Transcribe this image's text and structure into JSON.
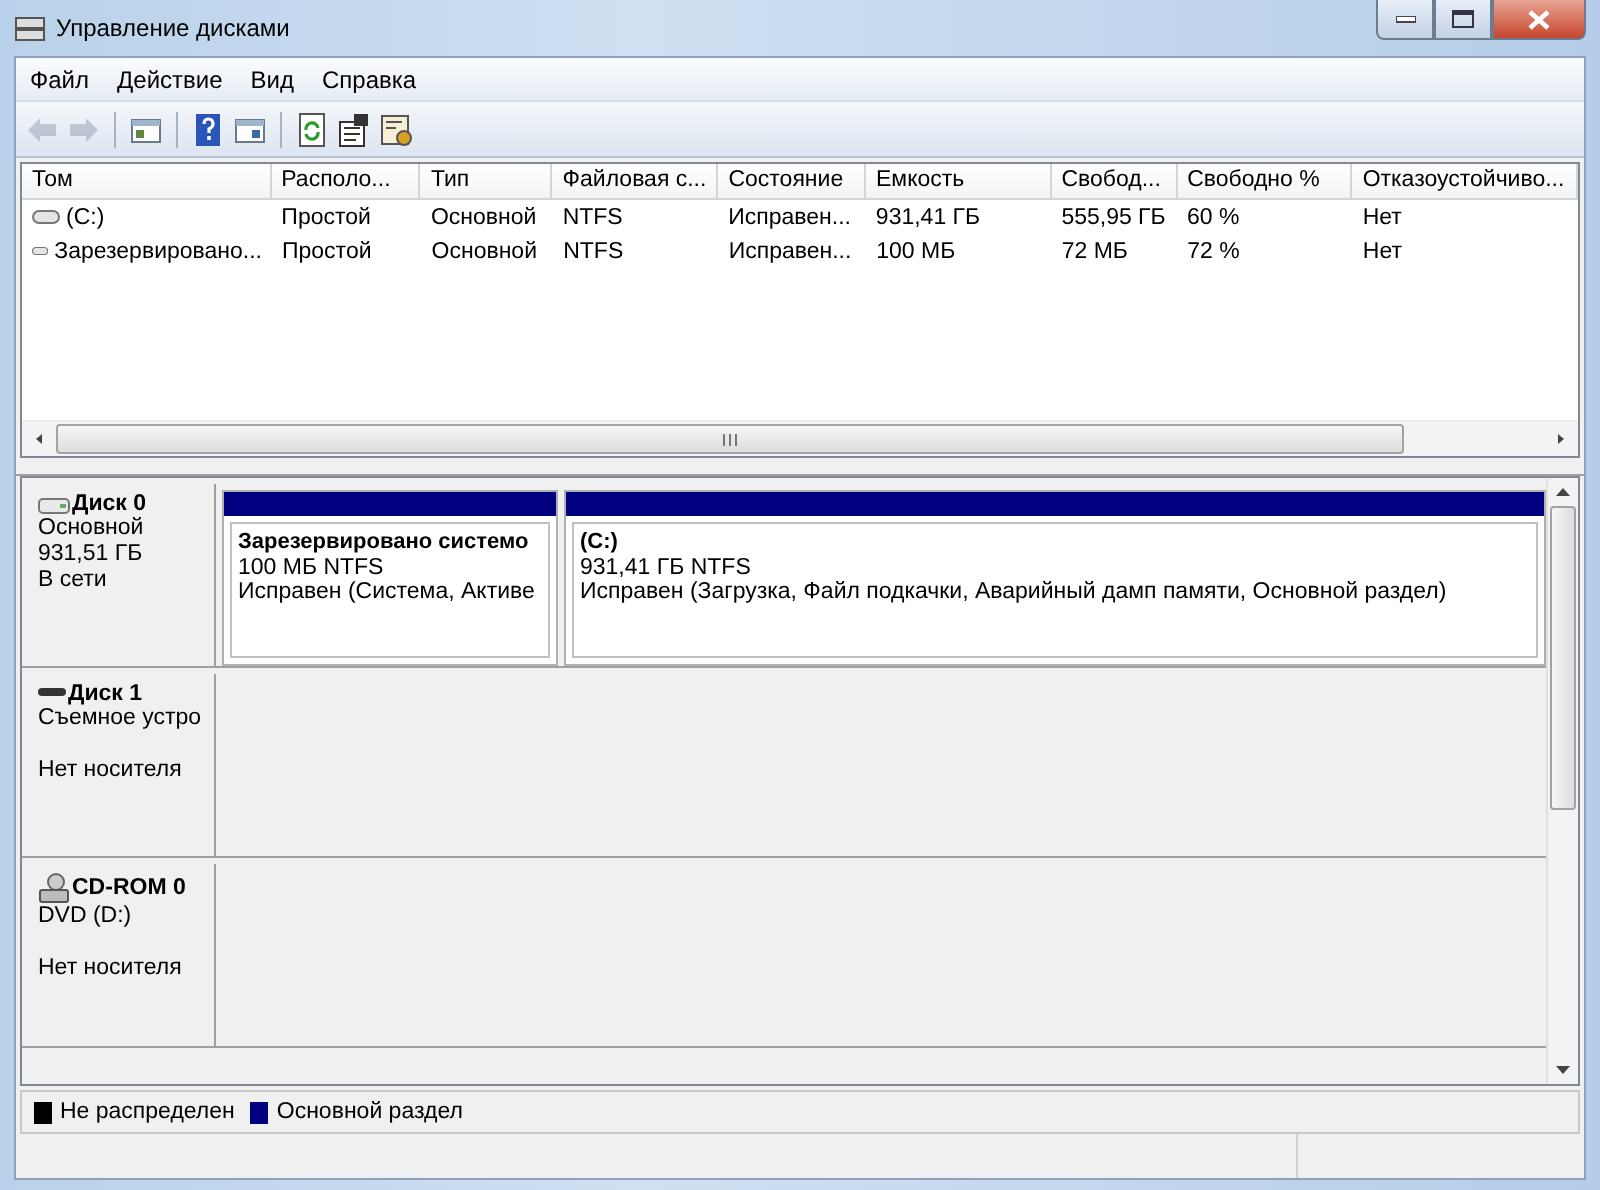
{
  "window": {
    "title": "Управление дисками"
  },
  "menu": [
    "Файл",
    "Действие",
    "Вид",
    "Справка"
  ],
  "toolbar": [
    {
      "kind": "back",
      "disabled": true
    },
    {
      "kind": "forward",
      "disabled": true
    },
    {
      "kind": "sep"
    },
    {
      "kind": "panel",
      "disabled": false
    },
    {
      "kind": "sep"
    },
    {
      "kind": "help",
      "disabled": false
    },
    {
      "kind": "panel2",
      "disabled": false
    },
    {
      "kind": "sep"
    },
    {
      "kind": "refresh",
      "disabled": false
    },
    {
      "kind": "properties",
      "disabled": false
    },
    {
      "kind": "settings",
      "disabled": false
    }
  ],
  "table": {
    "columns": [
      "Том",
      "Располо...",
      "Тип",
      "Файловая с...",
      "Состояние",
      "Емкость",
      "Свобод...",
      "Свободно %",
      "Отказоустойчиво..."
    ],
    "rows": [
      [
        "(C:)",
        "Простой",
        "Основной",
        "NTFS",
        "Исправен...",
        "931,41 ГБ",
        "555,95 ГБ",
        "60 %",
        "Нет"
      ],
      [
        "Зарезервировано...",
        "Простой",
        "Основной",
        "NTFS",
        "Исправен...",
        "100 МБ",
        "72 МБ",
        "72 %",
        "Нет"
      ]
    ]
  },
  "disks": [
    {
      "kind": "hdd",
      "name": "Диск 0",
      "lines": [
        "Основной",
        "931,51 ГБ"
      ],
      "status": "В сети",
      "partitions": [
        {
          "title": "Зарезервировано системо",
          "size": "100 МБ NTFS",
          "status": "Исправен (Система, Активе",
          "color": "#000080"
        },
        {
          "title": "(C:)",
          "size": "931,41 ГБ NTFS",
          "status": "Исправен (Загрузка, Файл подкачки, Аварийный дамп памяти, Основной раздел)",
          "color": "#000080"
        }
      ]
    },
    {
      "kind": "removable",
      "name": "Диск 1",
      "lines": [
        "Съемное устро"
      ],
      "status": "Нет носителя"
    },
    {
      "kind": "cdrom",
      "name": "CD-ROM 0",
      "lines": [
        "DVD (D:)"
      ],
      "status": "Нет носителя"
    }
  ],
  "legend": [
    {
      "label": "Не распределен",
      "color": "#000000"
    },
    {
      "label": "Основной раздел",
      "color": "#000080"
    }
  ]
}
